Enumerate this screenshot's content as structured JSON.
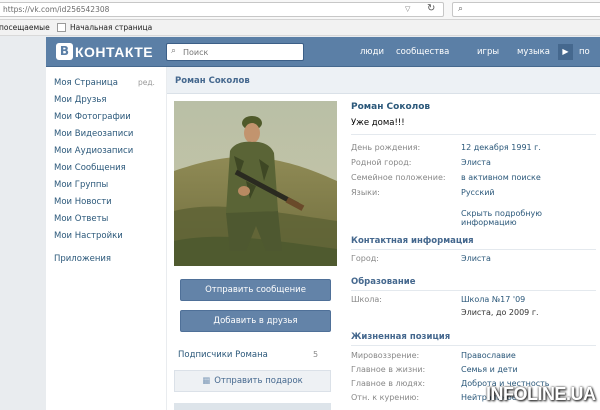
{
  "browser": {
    "url": "https://vk.com/id256542308",
    "search_placeholder": ""
  },
  "bookmarks": {
    "frequent": "посещаемые",
    "home": "Начальная страница"
  },
  "header": {
    "logo_letter": "B",
    "logo_text": "КОНТАКТЕ",
    "search_placeholder": "Поиск",
    "nav": [
      "люди",
      "сообщества",
      "игры",
      "музыка"
    ],
    "more_icon": "play-arrow-icon",
    "nav_tail": "по",
    "brand_color": "#5b7fa6"
  },
  "sidebar": {
    "edit_label": "ред.",
    "items": [
      "Моя Страница",
      "Мои Друзья",
      "Мои Фотографии",
      "Мои Видеозаписи",
      "Мои Аудиозаписи",
      "Мои Сообщения",
      "Мои Группы",
      "Мои Новости",
      "Мои Ответы",
      "Мои Настройки"
    ],
    "apps": "Приложения"
  },
  "profile": {
    "page_title": "Роман Соколов",
    "name": "Роман Соколов",
    "status": "Уже дома!!!",
    "buttons": {
      "message": "Отправить сообщение",
      "add_friend": "Добавить в друзья"
    },
    "subscribers_label": "Подписчики Романа",
    "subscribers_count": "5",
    "gift_label": "Отправить подарок",
    "info": {
      "birthday_label": "День рождения:",
      "birthday_value": "12 декабря 1991 г.",
      "hometown_label": "Родной город:",
      "hometown_value": "Элиста",
      "family_label": "Семейное положение:",
      "family_value": "в активном поиске",
      "languages_label": "Языки:",
      "languages_value": "Русский",
      "hide_details": "Скрыть подробную информацию"
    },
    "contacts": {
      "title": "Контактная информация",
      "city_label": "Город:",
      "city_value": "Элиста"
    },
    "education": {
      "title": "Образование",
      "school_label": "Школа:",
      "school_value": "Школа №17 '09",
      "school_detail": "Элиста, до 2009 г."
    },
    "life_position": {
      "title": "Жизненная позиция",
      "worldview_label": "Мировоззрение:",
      "worldview_value": "Православие",
      "main_life_label": "Главное в жизни:",
      "main_life_value": "Семья и дети",
      "main_people_label": "Главное в людях:",
      "main_people_value": "Доброта и честность",
      "smoking_label": "Отн. к курению:",
      "smoking_value": "Нейтральное"
    }
  },
  "watermark": "INFOLINE.UA"
}
